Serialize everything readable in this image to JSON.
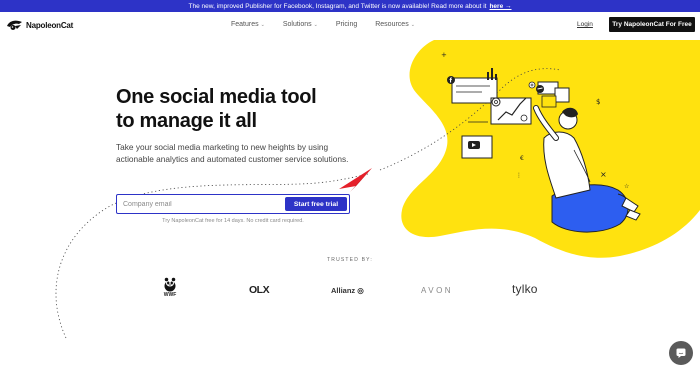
{
  "announcement": {
    "text": "The new, improved Publisher for Facebook, Instagram, and Twitter is now available! Read more about it",
    "link_label": "here →"
  },
  "nav": {
    "brand": "NapoleonCat",
    "menu": [
      {
        "label": "Features",
        "has_dropdown": true
      },
      {
        "label": "Solutions",
        "has_dropdown": true
      },
      {
        "label": "Pricing",
        "has_dropdown": false
      },
      {
        "label": "Resources",
        "has_dropdown": true
      }
    ],
    "login_label": "Login",
    "cta_label": "Try NapoleonCat For Free"
  },
  "hero": {
    "title_line1": "One social media tool",
    "title_line2": "to manage it all",
    "subtitle": "Take your social media marketing to new heights by using actionable analytics and automated customer service solutions.",
    "email_placeholder": "Company email",
    "email_value": "",
    "start_label": "Start free trial",
    "trial_note": "Try NapoleonCat free for 14 days. No credit card required."
  },
  "trusted": {
    "label": "TRUSTED BY:",
    "brands": [
      "WWF",
      "OLX",
      "Allianz",
      "AVON",
      "tylko"
    ]
  },
  "colors": {
    "accent_blue": "#2d33c7",
    "brand_yellow": "#ffe20f",
    "dark": "#111111",
    "paper_plane": "#e5202a"
  },
  "icons": [
    "chevron-down-icon",
    "arrow-right-icon",
    "chat-icon",
    "panda-logo-icon",
    "paper-plane-icon"
  ]
}
